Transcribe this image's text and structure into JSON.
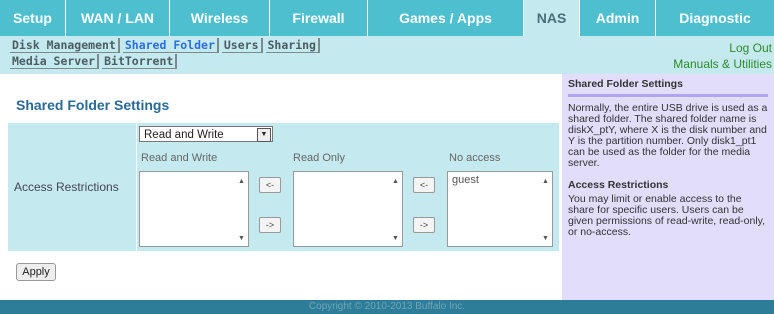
{
  "nav": {
    "tabs": [
      {
        "label": "Setup"
      },
      {
        "label": "WAN / LAN"
      },
      {
        "label": "Wireless"
      },
      {
        "label": "Firewall"
      },
      {
        "label": "Games / Apps"
      },
      {
        "label": "NAS"
      },
      {
        "label": "Admin"
      },
      {
        "label": "Diagnostic"
      }
    ],
    "active": "NAS"
  },
  "subnav": {
    "row1": [
      "Disk Management",
      "Shared Folder",
      "Users",
      "Sharing"
    ],
    "row2": [
      "Media Server",
      "BitTorrent"
    ],
    "active": "Shared Folder",
    "logout": "Log Out",
    "manuals": "Manuals & Utilities"
  },
  "main": {
    "title": "Shared Folder Settings",
    "row_label": "Access Restrictions",
    "select_value": "Read and Write",
    "columns": [
      "Read and Write",
      "Read Only",
      "No access"
    ],
    "no_access_items": [
      "guest"
    ],
    "move_left": "<-",
    "move_right": "->",
    "apply_label": "Apply"
  },
  "help": {
    "heading": "Shared Folder Settings",
    "para1": "Normally, the entire USB drive is used as a shared folder. The shared folder name is diskX_ptY, where X is the disk number and Y is the partition number. Only disk1_pt1 can be used as the folder for the media server.",
    "heading2": "Access Restrictions",
    "para2": "You may limit or enable access to the share for specific users. Users can be given permissions of read-write, read-only, or no-access."
  },
  "footer": "Copyright © 2010-2013 Buffalo Inc."
}
